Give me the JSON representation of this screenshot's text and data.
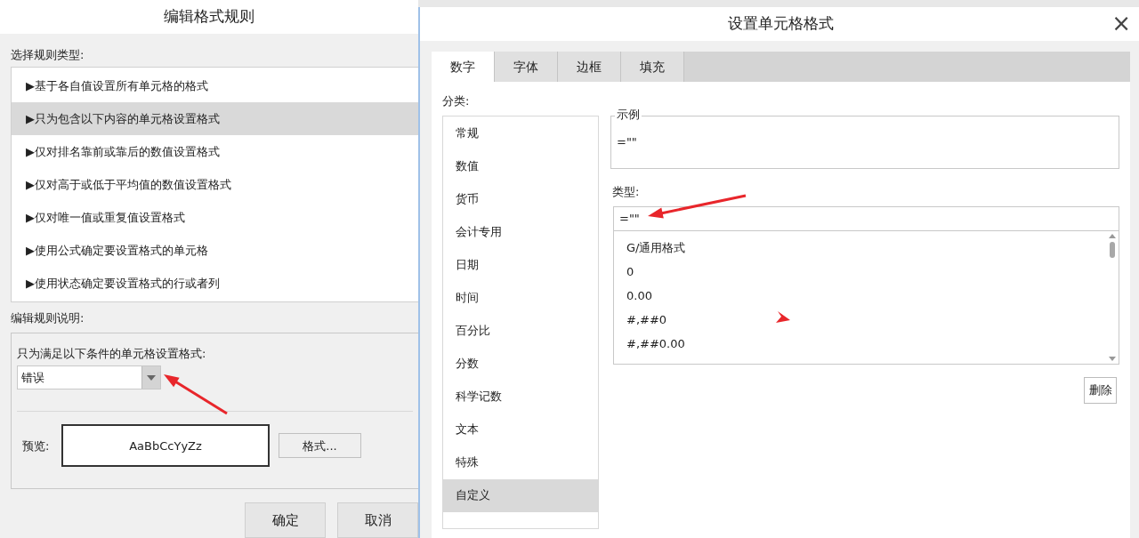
{
  "left_dialog": {
    "title": "编辑格式规则",
    "rule_type_label": "选择规则类型:",
    "rule_types": [
      {
        "label": "▶基于各自值设置所有单元格的格式",
        "selected": false
      },
      {
        "label": "▶只为包含以下内容的单元格设置格式",
        "selected": true
      },
      {
        "label": "▶仅对排名靠前或靠后的数值设置格式",
        "selected": false
      },
      {
        "label": "▶仅对高于或低于平均值的数值设置格式",
        "selected": false
      },
      {
        "label": "▶仅对唯一值或重复值设置格式",
        "selected": false
      },
      {
        "label": "▶使用公式确定要设置格式的单元格",
        "selected": false
      },
      {
        "label": "▶使用状态确定要设置格式的行或者列",
        "selected": false
      }
    ],
    "description_label": "编辑规则说明:",
    "condition_label": "只为满足以下条件的单元格设置格式:",
    "condition_select": {
      "value": "错误"
    },
    "preview_label": "预览:",
    "preview_text": "AaBbCcYyZz",
    "format_button": "格式...",
    "buttons": [
      "确定",
      "取消"
    ]
  },
  "right_dialog": {
    "title": "设置单元格格式",
    "close": "×",
    "tabs": [
      {
        "label": "数字",
        "selected": true
      },
      {
        "label": "字体",
        "selected": false
      },
      {
        "label": "边框",
        "selected": false
      },
      {
        "label": "填充",
        "selected": false
      }
    ],
    "category_label": "分类:",
    "categories": [
      {
        "label": "常规",
        "selected": false
      },
      {
        "label": "数值",
        "selected": false
      },
      {
        "label": "货币",
        "selected": false
      },
      {
        "label": "会计专用",
        "selected": false
      },
      {
        "label": "日期",
        "selected": false
      },
      {
        "label": "时间",
        "selected": false
      },
      {
        "label": "百分比",
        "selected": false
      },
      {
        "label": "分数",
        "selected": false
      },
      {
        "label": "科学记数",
        "selected": false
      },
      {
        "label": "文本",
        "selected": false
      },
      {
        "label": "特殊",
        "selected": false
      },
      {
        "label": "自定义",
        "selected": true
      }
    ],
    "sample_label": "示例",
    "sample_value": "=\"\"",
    "type_label": "类型:",
    "type_input": {
      "value": "=\"\""
    },
    "type_list": [
      "G/通用格式",
      "0",
      "0.00",
      "#,##0",
      "#,##0.00"
    ],
    "delete_button": "删除"
  }
}
